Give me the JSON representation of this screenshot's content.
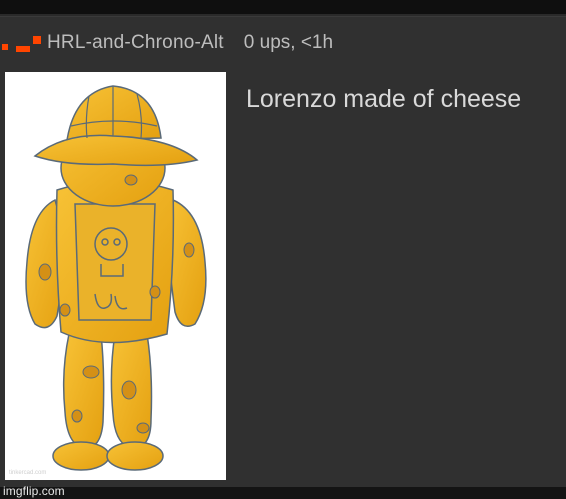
{
  "post": {
    "username": "HRL-and-Chrono-Alt",
    "meta": "0 ups, <1h",
    "title": "Lorenzo made of cheese"
  },
  "image": {
    "subject": "yellow cheese robot figure",
    "corner_mark": "tinkercad.com"
  },
  "watermark": "imgflip.com",
  "colors": {
    "accent": "#ff4500",
    "card_bg": "#303030",
    "figure_yellow": "#f0b020",
    "figure_outline": "#5a6a78"
  }
}
